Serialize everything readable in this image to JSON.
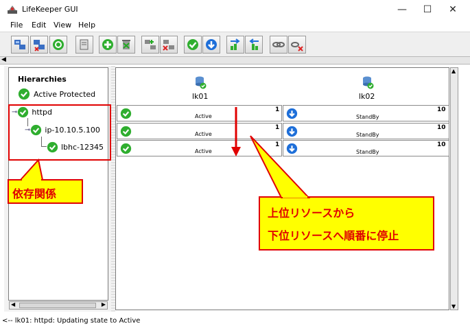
{
  "window": {
    "title": "LifeKeeper GUI",
    "minimize": "—",
    "maximize": "☐",
    "close": "✕"
  },
  "menu": {
    "file": "File",
    "edit": "Edit",
    "view": "View",
    "help": "Help"
  },
  "hierarchies": {
    "title": "Hierarchies",
    "status_label": "Active Protected",
    "tree": [
      {
        "label": "httpd"
      },
      {
        "label": "ip-10.10.5.100"
      },
      {
        "label": "lbhc-12345"
      }
    ]
  },
  "servers": [
    {
      "name": "lk01"
    },
    {
      "name": "lk02"
    }
  ],
  "resources": [
    {
      "lk01_state": "Active",
      "lk01_priority": "1",
      "lk02_state": "StandBy",
      "lk02_priority": "10"
    },
    {
      "lk01_state": "Active",
      "lk01_priority": "1",
      "lk02_state": "StandBy",
      "lk02_priority": "10"
    },
    {
      "lk01_state": "Active",
      "lk01_priority": "1",
      "lk02_state": "StandBy",
      "lk02_priority": "10"
    }
  ],
  "annotations": {
    "dependency": "依存関係",
    "callout_line1": "上位リソースから",
    "callout_line2": "下位リソースへ順番に停止"
  },
  "status": {
    "message": "<-- lk01: httpd: Updating state to Active"
  },
  "colors": {
    "active_green": "#2fae2f",
    "standby_blue": "#1e6fd9",
    "annotation_red": "#e00000",
    "annotation_yellow": "#ffff00"
  }
}
